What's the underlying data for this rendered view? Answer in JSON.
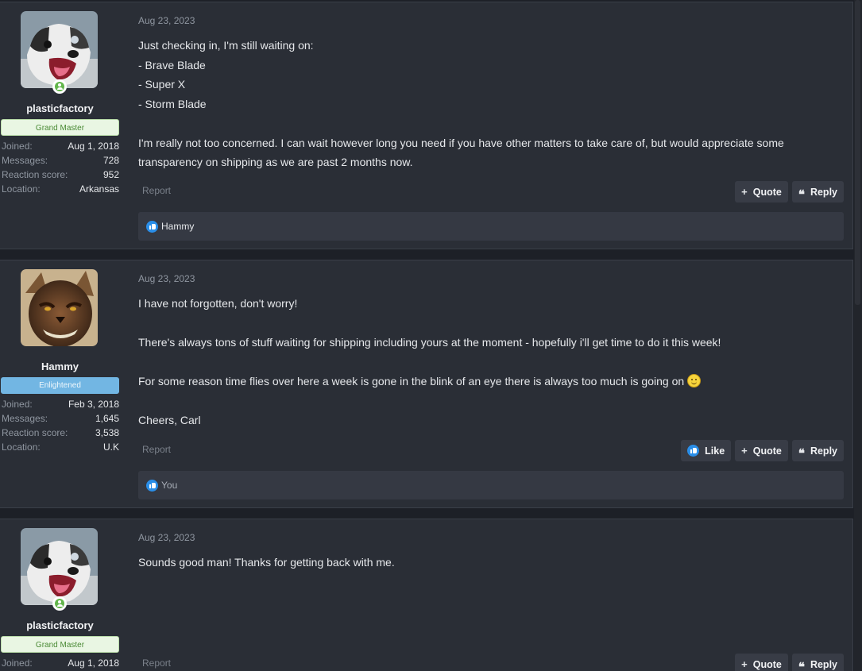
{
  "posts": [
    {
      "author": "plasticfactory",
      "rank": "Grand Master",
      "stats": [
        {
          "label": "Joined:",
          "value": "Aug 1, 2018"
        },
        {
          "label": "Messages:",
          "value": "728"
        },
        {
          "label": "Reaction score:",
          "value": "952"
        },
        {
          "label": "Location:",
          "value": "Arkansas"
        }
      ],
      "date": "Aug 23, 2023",
      "body": [
        "Just checking in, I'm still waiting on:",
        "- Brave Blade",
        "- Super X",
        "- Storm Blade",
        "",
        "I'm really not too concerned. I can wait however long you need if you have other matters to take care of, but would appreciate some",
        "transparency on shipping as we are past 2 months now."
      ],
      "report": "Report",
      "quote": "Quote",
      "reply": "Reply",
      "reaction_text": "Hammy"
    },
    {
      "author": "Hammy",
      "rank": "Enlightened",
      "stats": [
        {
          "label": "Joined:",
          "value": "Feb 3, 2018"
        },
        {
          "label": "Messages:",
          "value": "1,645"
        },
        {
          "label": "Reaction score:",
          "value": "3,538"
        },
        {
          "label": "Location:",
          "value": "U.K"
        }
      ],
      "date": "Aug 23, 2023",
      "body": [
        "I have not forgotten, don't worry!",
        "",
        "There's always tons of stuff waiting for shipping including yours at the moment - hopefully i'll get time to do it this week!",
        "",
        "For some reason time flies over here a week is gone in the blink of an eye there is always too much is going on",
        "",
        "Cheers, Carl"
      ],
      "report": "Report",
      "like": "Like",
      "quote": "Quote",
      "reply": "Reply",
      "reaction_text": "You"
    },
    {
      "author": "plasticfactory",
      "rank": "Grand Master",
      "stats": [
        {
          "label": "Joined:",
          "value": "Aug 1, 2018"
        }
      ],
      "date": "Aug 23, 2023",
      "body": [
        "Sounds good man! Thanks for getting back with me."
      ],
      "report": "Report",
      "quote": "Quote",
      "reply": "Reply"
    }
  ],
  "colors": {
    "background": "#1d2027",
    "post_bg": "#2a2e36",
    "grand_master_badge": "#e9f6e3",
    "enlightened_badge": "#72b6e3",
    "like_blue": "#2a8ee8",
    "online_green": "#63b64c"
  },
  "icons": {
    "online": "online-status-icon",
    "quote": "plus-icon",
    "reply": "quote-marks-icon",
    "like": "thumbs-up-icon",
    "emoji": "smile-emoji-icon"
  }
}
